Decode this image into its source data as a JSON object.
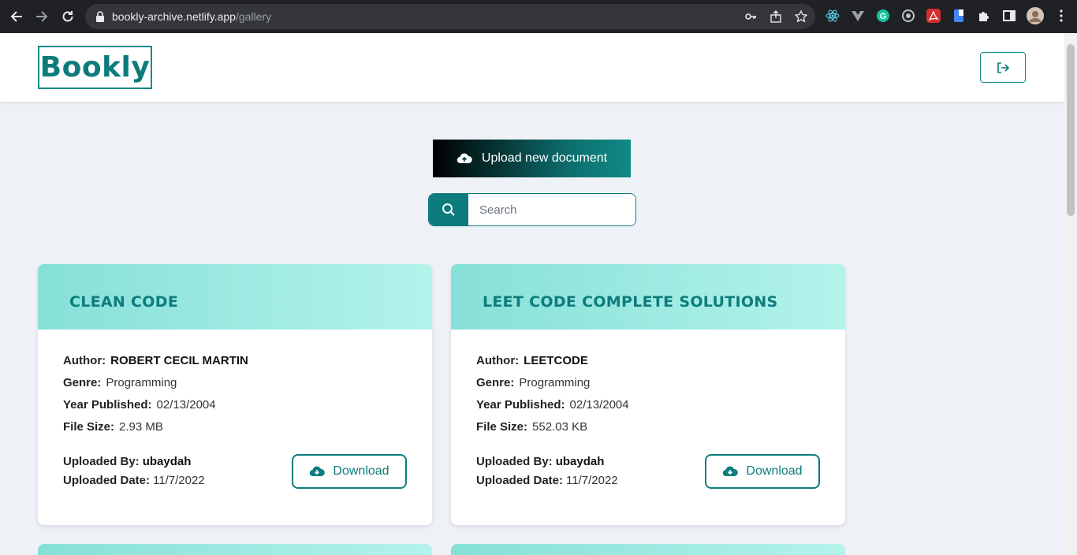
{
  "browser": {
    "url_host": "bookly-archive.netlify.app",
    "url_path": "/gallery"
  },
  "header": {
    "logo": "Bookly",
    "logout_icon": "logout-icon"
  },
  "actions": {
    "upload_label": "Upload new document",
    "upload_icon": "cloud-upload-icon"
  },
  "search": {
    "placeholder": "Search",
    "value": ""
  },
  "labels": {
    "author": "Author:",
    "genre": "Genre:",
    "year": "Year Published:",
    "size": "File Size:",
    "uploaded_by": "Uploaded By:",
    "uploaded_date": "Uploaded Date:",
    "download": "Download"
  },
  "documents": [
    {
      "title": "CLEAN CODE",
      "author": "ROBERT CECIL MARTIN",
      "genre": "Programming",
      "year": "02/13/2004",
      "size": "2.93 MB",
      "uploaded_by": "ubaydah",
      "uploaded_date": "11/7/2022"
    },
    {
      "title": "LEET CODE COMPLETE SOLUTIONS",
      "author": "LEETCODE",
      "genre": "Programming",
      "year": "02/13/2004",
      "size": "552.03 KB",
      "uploaded_by": "ubaydah",
      "uploaded_date": "11/7/2022"
    }
  ],
  "colors": {
    "brand": "#0d7c7c",
    "card_header_start": "#86e0d8",
    "card_header_end": "#b3f3ea",
    "page_bg": "#eef2f7"
  }
}
